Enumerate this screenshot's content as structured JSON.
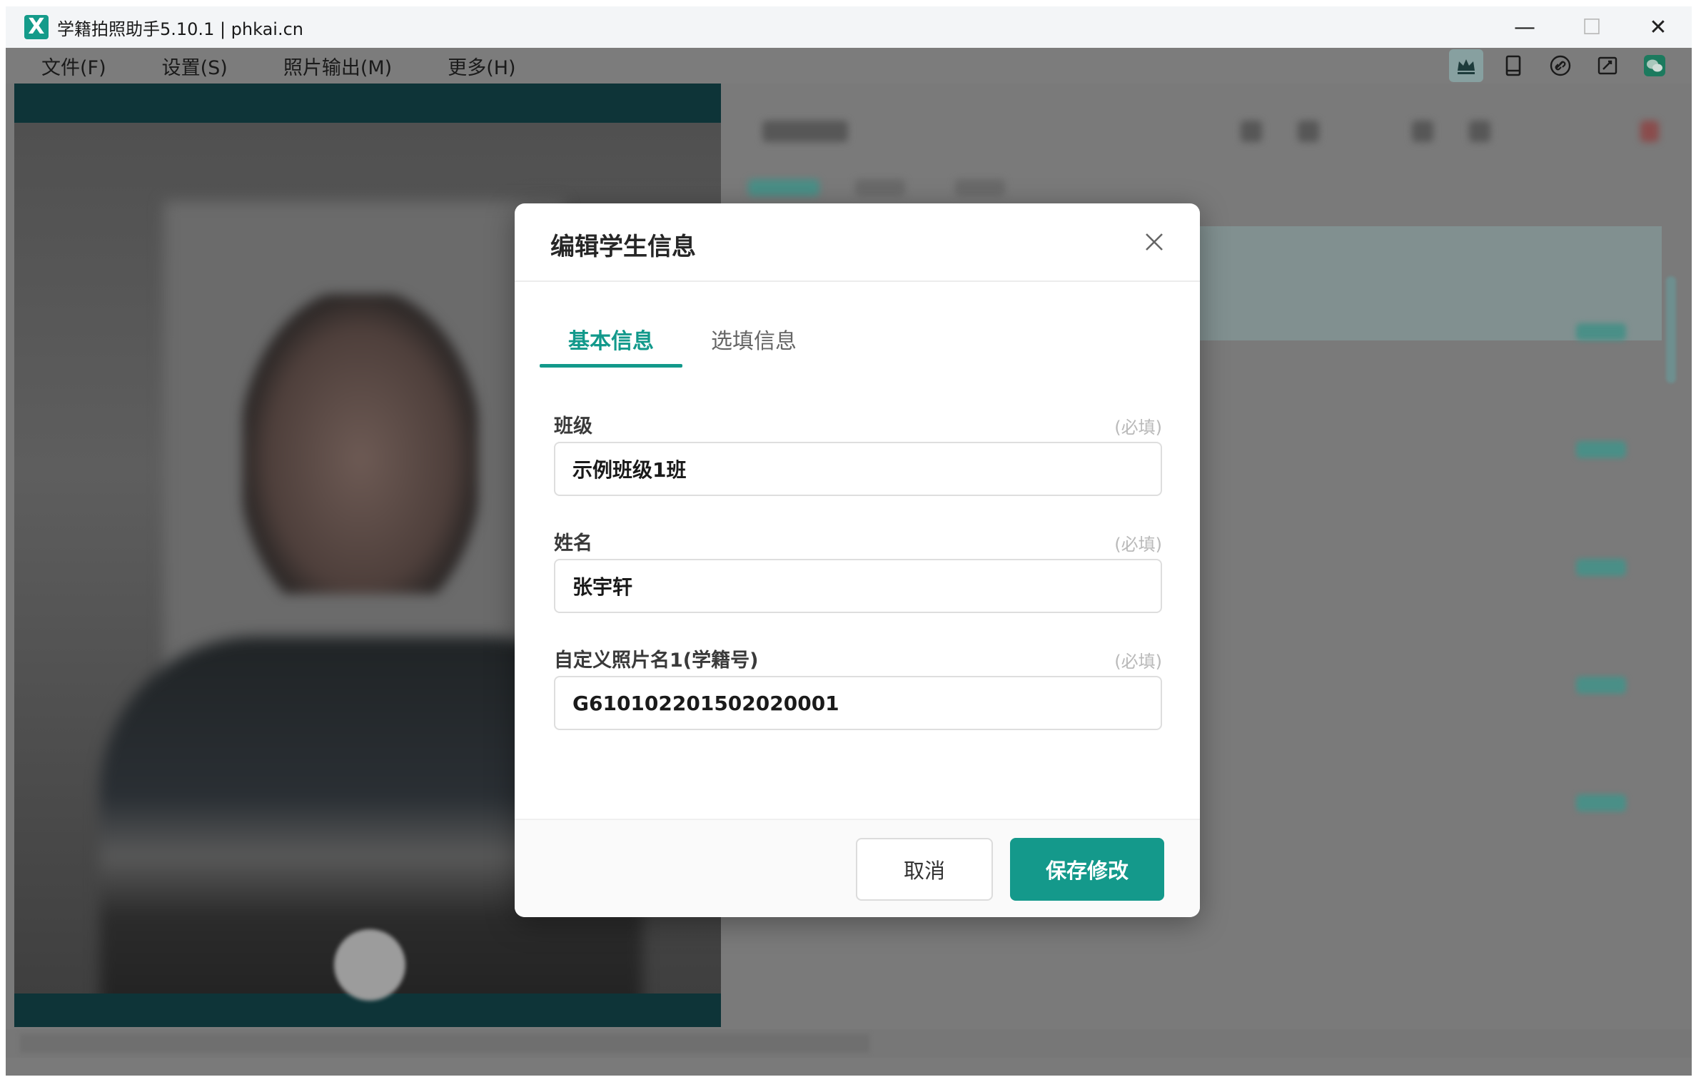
{
  "window": {
    "title": "学籍拍照助手5.10.1 | phkai.cn",
    "logo_glyph": "X",
    "minimize_glyph": "—",
    "maximize_glyph": "☐",
    "close_glyph": "✕"
  },
  "menu": {
    "items": [
      "文件(F)",
      "设置(S)",
      "照片输出(M)",
      "更多(H)"
    ]
  },
  "toolbar": {
    "icons": [
      "crown-icon",
      "tablet-icon",
      "link-icon",
      "edit-screen-icon",
      "wechat-icon"
    ],
    "accent": "#14998b"
  },
  "dialog": {
    "title": "编辑学生信息",
    "tabs": [
      {
        "label": "基本信息",
        "active": true
      },
      {
        "label": "选填信息",
        "active": false
      }
    ],
    "fields": [
      {
        "label": "班级",
        "required": "(必填)",
        "value": "示例班级1班"
      },
      {
        "label": "姓名",
        "required": "(必填)",
        "value": "张宇轩"
      },
      {
        "label": "自定义照片名1(学籍号)",
        "required": "(必填)",
        "value": "G610102201502020001"
      }
    ],
    "cancel_label": "取消",
    "save_label": "保存修改"
  },
  "colors": {
    "primary": "#14998b",
    "overlay": "#7a7a7a"
  }
}
